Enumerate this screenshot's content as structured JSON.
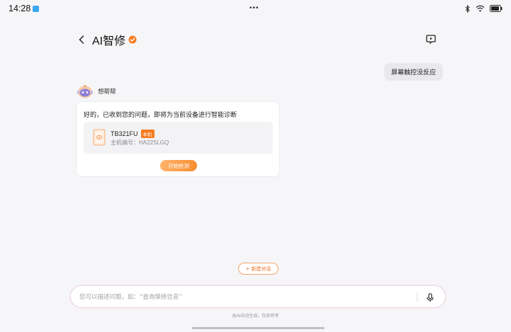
{
  "status_bar": {
    "time": "14:28",
    "center_dots": "•••",
    "icons": [
      "app-notification-icon",
      "bluetooth-icon",
      "wifi-icon",
      "battery-icon"
    ]
  },
  "header": {
    "back_icon": "chevron-left-icon",
    "title": "AI智修",
    "verified_icon": "verified-badge-icon",
    "history_icon": "chat-history-icon"
  },
  "chat": {
    "user_message": "屏幕触控没反应",
    "bot": {
      "name": "想帮帮",
      "message": "好的，已收到您的问题，即将为当前设备进行智能诊断",
      "device": {
        "model": "TB321FU",
        "badge": "本机",
        "serial": "主机编号：HA22SLGQ"
      },
      "action_label": "开始检测"
    }
  },
  "new_chat": {
    "icon": "+",
    "label": "新建对话"
  },
  "input": {
    "placeholder": "您可以描述问题，如：“查询保修信息”",
    "value": "",
    "mic_icon": "microphone-icon"
  },
  "disclaimer": "由AI自动生成，仅供参考",
  "colors": {
    "accent": "#f47b20",
    "background": "#f6f6f8",
    "bubble": "#e9e9ec",
    "card": "#ffffff"
  }
}
